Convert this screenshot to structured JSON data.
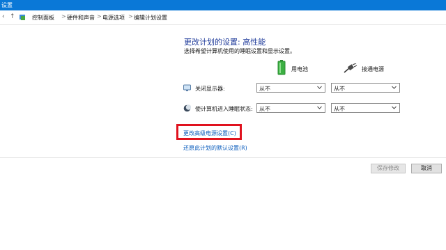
{
  "window": {
    "title": "设置"
  },
  "addressbar": {
    "back_icon": "back-arrow-icon",
    "up_icon": "up-arrow-icon",
    "breadcrumb": [
      "控制面板",
      "硬件和声音",
      "电源选项",
      "编辑计划设置"
    ],
    "separator": ">"
  },
  "main": {
    "heading": "更改计划的设置: 高性能",
    "subtitle": "选择希望计算机使用的睡眠设置和显示设置。",
    "columns": {
      "battery": "用电池",
      "plugged": "接通电源"
    },
    "rows": [
      {
        "label": "关闭显示器:",
        "icon": "monitor-icon",
        "battery_value": "从不",
        "plugged_value": "从不"
      },
      {
        "label": "使计算机进入睡眠状态:",
        "icon": "moon-icon",
        "battery_value": "从不",
        "plugged_value": "从不"
      }
    ],
    "links": {
      "advanced": "更改高级电源设置(C)",
      "restore": "还原此计划的默认设置(R)"
    }
  },
  "footer": {
    "save": "保存修改",
    "cancel": "取消"
  },
  "colors": {
    "titlebar": "#0a78d7",
    "heading": "#1e3a9a",
    "link": "#0b5dbd",
    "highlight": "#e0121e",
    "battery_green": "#3cb043"
  }
}
